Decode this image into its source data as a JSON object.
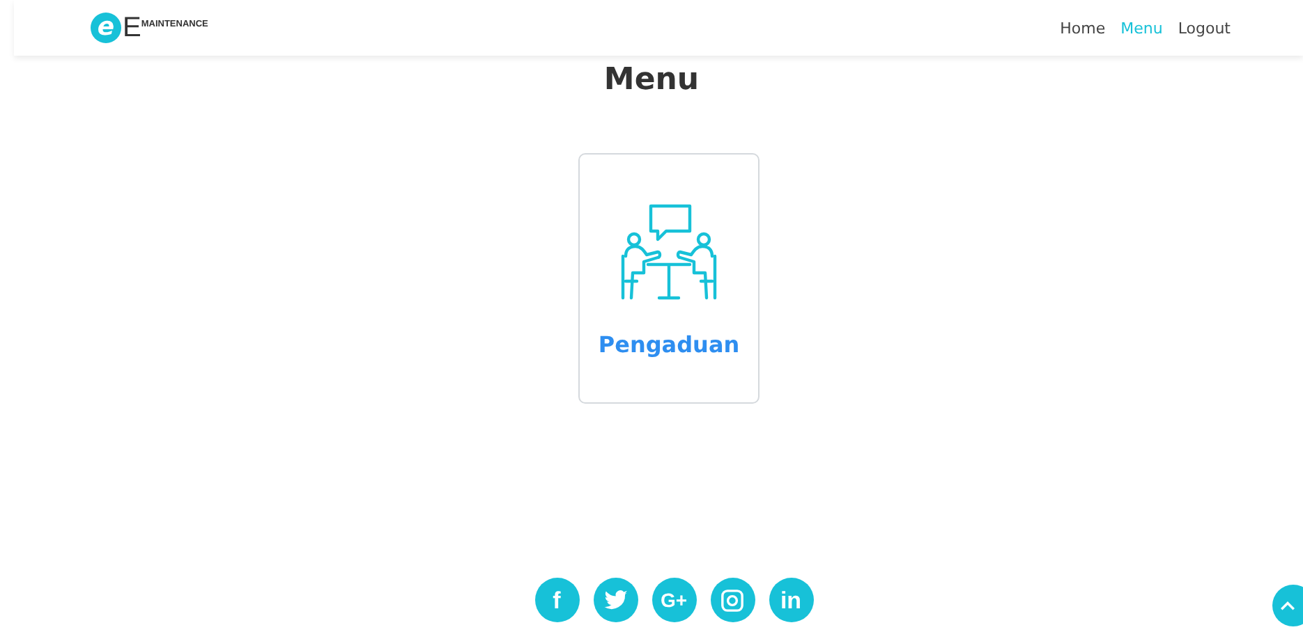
{
  "logo": {
    "letter": "e",
    "initial": "E",
    "word": "MAINTENANCE"
  },
  "nav": [
    {
      "label": "Home",
      "selected": false
    },
    {
      "label": "Menu",
      "selected": true
    },
    {
      "label": "Logout",
      "selected": false
    }
  ],
  "title": "Menu",
  "cards": [
    {
      "label": "Pengaduan"
    }
  ],
  "social": [
    {
      "kind": "facebook",
      "glyph": "f"
    },
    {
      "kind": "twitter"
    },
    {
      "kind": "googleplus",
      "glyph": "G+"
    },
    {
      "kind": "instagram"
    },
    {
      "kind": "linkedin",
      "glyph": "in"
    }
  ]
}
